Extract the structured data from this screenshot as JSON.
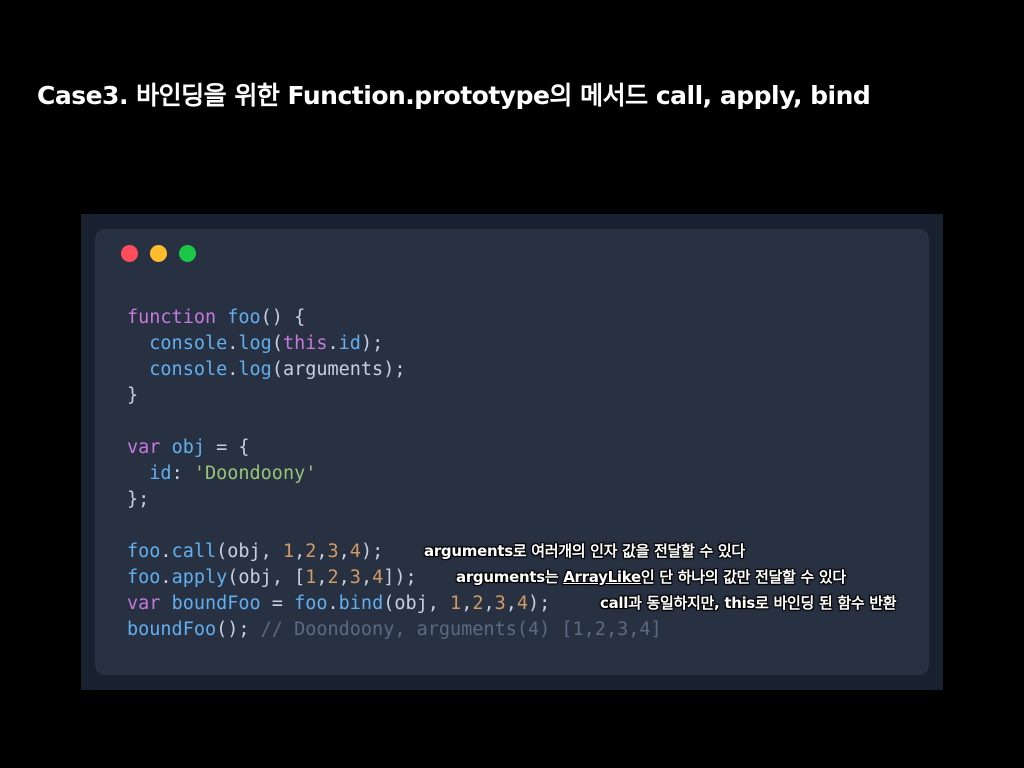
{
  "title": "Case3. 바인딩을 위한 Function.prototype의 메서드 call, apply, bind",
  "window_dots": [
    "red",
    "yellow",
    "green"
  ],
  "code": {
    "lines": [
      [
        {
          "t": "function",
          "c": "kw"
        },
        {
          "t": " ",
          "c": "pl"
        },
        {
          "t": "foo",
          "c": "fn"
        },
        {
          "t": "() {",
          "c": "pl"
        }
      ],
      [
        {
          "t": "  ",
          "c": "pl"
        },
        {
          "t": "console",
          "c": "fn"
        },
        {
          "t": ".",
          "c": "pl"
        },
        {
          "t": "log",
          "c": "fn"
        },
        {
          "t": "(",
          "c": "pl"
        },
        {
          "t": "this",
          "c": "kw"
        },
        {
          "t": ".",
          "c": "pl"
        },
        {
          "t": "id",
          "c": "prop"
        },
        {
          "t": ");",
          "c": "pl"
        }
      ],
      [
        {
          "t": "  ",
          "c": "pl"
        },
        {
          "t": "console",
          "c": "fn"
        },
        {
          "t": ".",
          "c": "pl"
        },
        {
          "t": "log",
          "c": "fn"
        },
        {
          "t": "(arguments);",
          "c": "pl"
        }
      ],
      [
        {
          "t": "}",
          "c": "pl"
        }
      ],
      [],
      [
        {
          "t": "var",
          "c": "kw"
        },
        {
          "t": " ",
          "c": "pl"
        },
        {
          "t": "obj",
          "c": "fn"
        },
        {
          "t": " = {",
          "c": "pl"
        }
      ],
      [
        {
          "t": "  ",
          "c": "pl"
        },
        {
          "t": "id",
          "c": "prop"
        },
        {
          "t": ": ",
          "c": "pl"
        },
        {
          "t": "'Doondoony'",
          "c": "str"
        }
      ],
      [
        {
          "t": "};",
          "c": "pl"
        }
      ],
      [],
      [
        {
          "t": "foo",
          "c": "fn"
        },
        {
          "t": ".",
          "c": "pl"
        },
        {
          "t": "call",
          "c": "fn"
        },
        {
          "t": "(obj, ",
          "c": "pl"
        },
        {
          "t": "1",
          "c": "num"
        },
        {
          "t": ",",
          "c": "pl"
        },
        {
          "t": "2",
          "c": "num"
        },
        {
          "t": ",",
          "c": "pl"
        },
        {
          "t": "3",
          "c": "num"
        },
        {
          "t": ",",
          "c": "pl"
        },
        {
          "t": "4",
          "c": "num"
        },
        {
          "t": ");",
          "c": "pl"
        }
      ],
      [
        {
          "t": "foo",
          "c": "fn"
        },
        {
          "t": ".",
          "c": "pl"
        },
        {
          "t": "apply",
          "c": "fn"
        },
        {
          "t": "(obj, [",
          "c": "pl"
        },
        {
          "t": "1",
          "c": "num"
        },
        {
          "t": ",",
          "c": "pl"
        },
        {
          "t": "2",
          "c": "num"
        },
        {
          "t": ",",
          "c": "pl"
        },
        {
          "t": "3",
          "c": "num"
        },
        {
          "t": ",",
          "c": "pl"
        },
        {
          "t": "4",
          "c": "num"
        },
        {
          "t": "]);",
          "c": "pl"
        }
      ],
      [
        {
          "t": "var",
          "c": "kw"
        },
        {
          "t": " ",
          "c": "pl"
        },
        {
          "t": "boundFoo",
          "c": "fn"
        },
        {
          "t": " = ",
          "c": "pl"
        },
        {
          "t": "foo",
          "c": "fn"
        },
        {
          "t": ".",
          "c": "pl"
        },
        {
          "t": "bind",
          "c": "fn"
        },
        {
          "t": "(obj, ",
          "c": "pl"
        },
        {
          "t": "1",
          "c": "num"
        },
        {
          "t": ",",
          "c": "pl"
        },
        {
          "t": "2",
          "c": "num"
        },
        {
          "t": ",",
          "c": "pl"
        },
        {
          "t": "3",
          "c": "num"
        },
        {
          "t": ",",
          "c": "pl"
        },
        {
          "t": "4",
          "c": "num"
        },
        {
          "t": ");",
          "c": "pl"
        }
      ],
      [
        {
          "t": "boundFoo",
          "c": "fn"
        },
        {
          "t": "(); ",
          "c": "pl"
        },
        {
          "t": "// Doondoony, arguments(4) [1,2,3,4]",
          "c": "cm"
        }
      ]
    ]
  },
  "annotations": {
    "call": "arguments로 여러개의 인자 값을 전달할 수 있다",
    "apply_prefix": "arguments는 ",
    "apply_underlined": "ArrayLike",
    "apply_suffix": "인 단 하나의 값만 전달할 수 있다",
    "bind": "call과 동일하지만, this로 바인딩 된 함수 반환"
  }
}
